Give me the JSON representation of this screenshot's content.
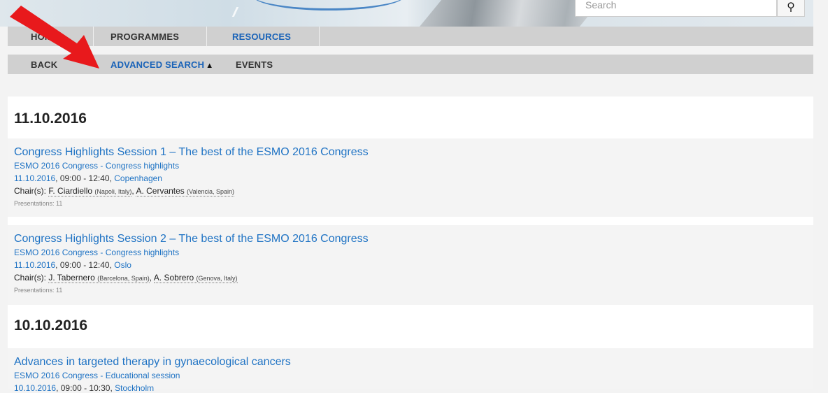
{
  "header": {
    "search_placeholder": "Search",
    "search_button_glyph": "⚲"
  },
  "nav_primary": [
    {
      "label": "HOME",
      "active": false
    },
    {
      "label": "PROGRAMMES",
      "active": false
    },
    {
      "label": "RESOURCES",
      "active": true
    }
  ],
  "nav_secondary": [
    {
      "label": "BACK",
      "active": false
    },
    {
      "label": "ADVANCED SEARCH",
      "active": true,
      "caret": "▲"
    },
    {
      "label": "EVENTS",
      "active": false
    }
  ],
  "days": [
    {
      "date": "11.10.2016",
      "sessions": [
        {
          "title": "Congress Highlights Session 1 – The best of the ESMO 2016 Congress",
          "subtitle": "ESMO 2016 Congress - Congress highlights",
          "date_link": "11.10.2016",
          "time": ", 09:00 - 12:40, ",
          "location": "Copenhagen",
          "chairs_label": "Chair(s):",
          "chairs": [
            {
              "name": "F. Ciardiello",
              "affiliation": "(Napoli, Italy)"
            },
            {
              "name": "A. Cervantes",
              "affiliation": "(Valencia, Spain)"
            }
          ],
          "presentations": "Presentations: 11"
        },
        {
          "title": "Congress Highlights Session 2 – The best of the ESMO 2016 Congress",
          "subtitle": "ESMO 2016 Congress - Congress highlights",
          "date_link": "11.10.2016",
          "time": ", 09:00 - 12:40, ",
          "location": "Oslo",
          "chairs_label": "Chair(s):",
          "chairs": [
            {
              "name": "J. Tabernero",
              "affiliation": "(Barcelona, Spain)"
            },
            {
              "name": "A. Sobrero",
              "affiliation": "(Genova, Italy)"
            }
          ],
          "presentations": "Presentations: 11"
        }
      ]
    },
    {
      "date": "10.10.2016",
      "sessions": [
        {
          "title": "Advances in targeted therapy in gynaecological cancers",
          "subtitle": "ESMO 2016 Congress - Educational session",
          "date_link": "10.10.2016",
          "time": ", 09:00 - 10:30, ",
          "location": "Stockholm"
        }
      ]
    }
  ],
  "annotation": {
    "arrow_color": "#e8191c"
  }
}
